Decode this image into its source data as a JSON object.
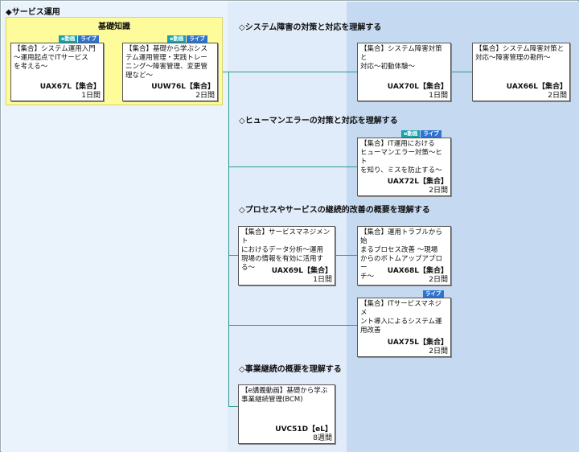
{
  "page": {
    "title": "◆サービス運用"
  },
  "kiso": {
    "title": "基礎知識"
  },
  "badges": {
    "e_video": "e動画",
    "live": "ライブ"
  },
  "sections": {
    "system_failure": "◇システム障害の対策と対応を理解する",
    "human_error": "◇ヒューマンエラーの対策と対応を理解する",
    "process": "◇プロセスやサービスの継続的改善の概要を理解する",
    "bcm": "◇事業継続の概要を理解する"
  },
  "courses": {
    "uax67l": {
      "name": "【集合】システム運用入門\n～運用起点でITサービス\nを考える～",
      "code": "UAX67L【集合】",
      "duration": "1日間"
    },
    "uuw76l": {
      "name": "【集合】基礎から学ぶシス\nテム運用管理・実践トレー\nニング～障害管理、変更管\n理など～",
      "code": "UUW76L【集合】",
      "duration": "2日間"
    },
    "uax70l": {
      "name": "【集合】システム障害対策と\n対応～初動体験～",
      "code": "UAX70L【集合】",
      "duration": "1日間"
    },
    "uax66l": {
      "name": "【集合】システム障害対策と\n対応～障害管理の勘所～",
      "code": "UAX66L【集合】",
      "duration": "2日間"
    },
    "uax72l": {
      "name": "【集合】IT運用における\nヒューマンエラー対策～ヒト\nを知り、ミスを防止する～",
      "code": "UAX72L【集合】",
      "duration": "2日間"
    },
    "uax69l": {
      "name": "【集合】サービスマネジメント\nにおけるデータ分析～運用\n現場の情報を有効に活用す\nる～",
      "code": "UAX69L【集合】",
      "duration": "1日間"
    },
    "uax68l": {
      "name": "【集合】運用トラブルから始\nまるプロセス改善 ～現場\nからのボトムアップアプロー\nチ～",
      "code": "UAX68L【集合】",
      "duration": "2日間"
    },
    "uax75l": {
      "name": "【集合】ITサービスマネジメ\nント導入によるシステム運\n用改善",
      "code": "UAX75L【集合】",
      "duration": "2日間"
    },
    "uvc51d": {
      "name": "【e講義動画】基礎から学ぶ\n事業継続管理(BCM)",
      "code": "UVC51D【eL】",
      "duration": "8週間"
    }
  },
  "colors": {
    "zone_left": "#eaf2fc",
    "zone_mid": "#e1ecfa",
    "zone_right": "#c5d9f1",
    "kiso_bg": "#fdfb9a",
    "connector": "#2f9a8a",
    "badge_e": "#17a2a8",
    "badge_live": "#2f74cc"
  }
}
